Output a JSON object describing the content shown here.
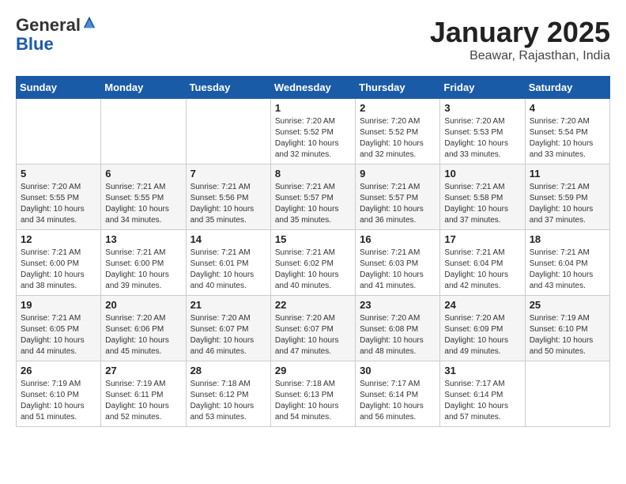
{
  "header": {
    "logo_general": "General",
    "logo_blue": "Blue",
    "month_title": "January 2025",
    "location": "Beawar, Rajasthan, India"
  },
  "days_of_week": [
    "Sunday",
    "Monday",
    "Tuesday",
    "Wednesday",
    "Thursday",
    "Friday",
    "Saturday"
  ],
  "weeks": [
    [
      {
        "day": "",
        "info": ""
      },
      {
        "day": "",
        "info": ""
      },
      {
        "day": "",
        "info": ""
      },
      {
        "day": "1",
        "info": "Sunrise: 7:20 AM\nSunset: 5:52 PM\nDaylight: 10 hours\nand 32 minutes."
      },
      {
        "day": "2",
        "info": "Sunrise: 7:20 AM\nSunset: 5:52 PM\nDaylight: 10 hours\nand 32 minutes."
      },
      {
        "day": "3",
        "info": "Sunrise: 7:20 AM\nSunset: 5:53 PM\nDaylight: 10 hours\nand 33 minutes."
      },
      {
        "day": "4",
        "info": "Sunrise: 7:20 AM\nSunset: 5:54 PM\nDaylight: 10 hours\nand 33 minutes."
      }
    ],
    [
      {
        "day": "5",
        "info": "Sunrise: 7:20 AM\nSunset: 5:55 PM\nDaylight: 10 hours\nand 34 minutes."
      },
      {
        "day": "6",
        "info": "Sunrise: 7:21 AM\nSunset: 5:55 PM\nDaylight: 10 hours\nand 34 minutes."
      },
      {
        "day": "7",
        "info": "Sunrise: 7:21 AM\nSunset: 5:56 PM\nDaylight: 10 hours\nand 35 minutes."
      },
      {
        "day": "8",
        "info": "Sunrise: 7:21 AM\nSunset: 5:57 PM\nDaylight: 10 hours\nand 35 minutes."
      },
      {
        "day": "9",
        "info": "Sunrise: 7:21 AM\nSunset: 5:57 PM\nDaylight: 10 hours\nand 36 minutes."
      },
      {
        "day": "10",
        "info": "Sunrise: 7:21 AM\nSunset: 5:58 PM\nDaylight: 10 hours\nand 37 minutes."
      },
      {
        "day": "11",
        "info": "Sunrise: 7:21 AM\nSunset: 5:59 PM\nDaylight: 10 hours\nand 37 minutes."
      }
    ],
    [
      {
        "day": "12",
        "info": "Sunrise: 7:21 AM\nSunset: 6:00 PM\nDaylight: 10 hours\nand 38 minutes."
      },
      {
        "day": "13",
        "info": "Sunrise: 7:21 AM\nSunset: 6:00 PM\nDaylight: 10 hours\nand 39 minutes."
      },
      {
        "day": "14",
        "info": "Sunrise: 7:21 AM\nSunset: 6:01 PM\nDaylight: 10 hours\nand 40 minutes."
      },
      {
        "day": "15",
        "info": "Sunrise: 7:21 AM\nSunset: 6:02 PM\nDaylight: 10 hours\nand 40 minutes."
      },
      {
        "day": "16",
        "info": "Sunrise: 7:21 AM\nSunset: 6:03 PM\nDaylight: 10 hours\nand 41 minutes."
      },
      {
        "day": "17",
        "info": "Sunrise: 7:21 AM\nSunset: 6:04 PM\nDaylight: 10 hours\nand 42 minutes."
      },
      {
        "day": "18",
        "info": "Sunrise: 7:21 AM\nSunset: 6:04 PM\nDaylight: 10 hours\nand 43 minutes."
      }
    ],
    [
      {
        "day": "19",
        "info": "Sunrise: 7:21 AM\nSunset: 6:05 PM\nDaylight: 10 hours\nand 44 minutes."
      },
      {
        "day": "20",
        "info": "Sunrise: 7:20 AM\nSunset: 6:06 PM\nDaylight: 10 hours\nand 45 minutes."
      },
      {
        "day": "21",
        "info": "Sunrise: 7:20 AM\nSunset: 6:07 PM\nDaylight: 10 hours\nand 46 minutes."
      },
      {
        "day": "22",
        "info": "Sunrise: 7:20 AM\nSunset: 6:07 PM\nDaylight: 10 hours\nand 47 minutes."
      },
      {
        "day": "23",
        "info": "Sunrise: 7:20 AM\nSunset: 6:08 PM\nDaylight: 10 hours\nand 48 minutes."
      },
      {
        "day": "24",
        "info": "Sunrise: 7:20 AM\nSunset: 6:09 PM\nDaylight: 10 hours\nand 49 minutes."
      },
      {
        "day": "25",
        "info": "Sunrise: 7:19 AM\nSunset: 6:10 PM\nDaylight: 10 hours\nand 50 minutes."
      }
    ],
    [
      {
        "day": "26",
        "info": "Sunrise: 7:19 AM\nSunset: 6:10 PM\nDaylight: 10 hours\nand 51 minutes."
      },
      {
        "day": "27",
        "info": "Sunrise: 7:19 AM\nSunset: 6:11 PM\nDaylight: 10 hours\nand 52 minutes."
      },
      {
        "day": "28",
        "info": "Sunrise: 7:18 AM\nSunset: 6:12 PM\nDaylight: 10 hours\nand 53 minutes."
      },
      {
        "day": "29",
        "info": "Sunrise: 7:18 AM\nSunset: 6:13 PM\nDaylight: 10 hours\nand 54 minutes."
      },
      {
        "day": "30",
        "info": "Sunrise: 7:17 AM\nSunset: 6:14 PM\nDaylight: 10 hours\nand 56 minutes."
      },
      {
        "day": "31",
        "info": "Sunrise: 7:17 AM\nSunset: 6:14 PM\nDaylight: 10 hours\nand 57 minutes."
      },
      {
        "day": "",
        "info": ""
      }
    ]
  ]
}
